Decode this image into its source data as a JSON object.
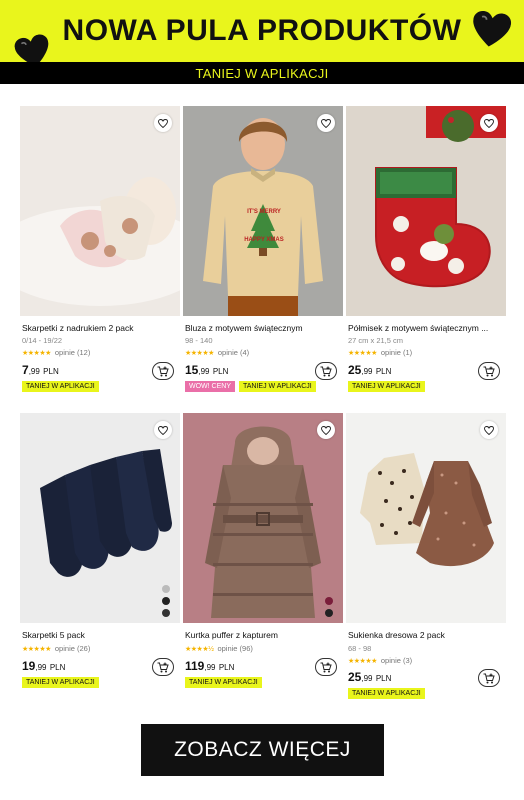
{
  "banner": {
    "title": "NOWA PULA PRODUKTÓW",
    "subtitle": "TANIEJ W APLIKACJI"
  },
  "products": [
    {
      "name": "Skarpetki z nadrukiem 2 pack",
      "size": "0/14 - 19/22",
      "stars": "★★★★★",
      "reviews": "opinie (12)",
      "price_int": "7",
      "price_dec": ",99",
      "currency": "PLN",
      "tags": [
        "TANIEJ W APLIKACJI"
      ]
    },
    {
      "name": "Bluza z motywem świątecznym",
      "size": "98 - 140",
      "stars": "★★★★★",
      "reviews": "opinie (4)",
      "price_int": "15",
      "price_dec": ",99",
      "currency": "PLN",
      "tags": [
        "WOW! CENY",
        "TANIEJ W APLIKACJI"
      ],
      "sweater_text": "IT'S MERRY HAPPY XMAS"
    },
    {
      "name": "Półmisek z motywem świątecznym ...",
      "size": "27 cm x 21,5 cm",
      "stars": "★★★★★",
      "reviews": "opinie (1)",
      "price_int": "25",
      "price_dec": ",99",
      "currency": "PLN",
      "tags": [
        "TANIEJ W APLIKACJI"
      ]
    },
    {
      "name": "Skarpetki 5 pack",
      "size": "",
      "stars": "★★★★★",
      "reviews": "opinie (26)",
      "price_int": "19",
      "price_dec": ",99",
      "currency": "PLN",
      "tags": [
        "TANIEJ W APLIKACJI"
      ]
    },
    {
      "name": "Kurtka puffer z kapturem",
      "size": "",
      "stars": "★★★★½",
      "reviews": "opinie (96)",
      "price_int": "119",
      "price_dec": ",99",
      "currency": "PLN",
      "tags": [
        "TANIEJ W APLIKACJI"
      ]
    },
    {
      "name": "Sukienka dresowa 2 pack",
      "size": "68 - 98",
      "stars": "★★★★★",
      "reviews": "opinie (3)",
      "price_int": "25",
      "price_dec": ",99",
      "currency": "PLN",
      "tags": [
        "TANIEJ W APLIKACJI"
      ]
    }
  ],
  "cta": {
    "label": "ZOBACZ WIĘCEJ"
  },
  "colors": {
    "accent": "#e9f51c",
    "dark": "#111111",
    "pink_tag": "#ea6fa8",
    "star": "#f5b400"
  },
  "icons": {
    "favorite": "heart-outline-icon",
    "cart": "add-to-cart-icon",
    "decor": "black-heart-icon"
  }
}
